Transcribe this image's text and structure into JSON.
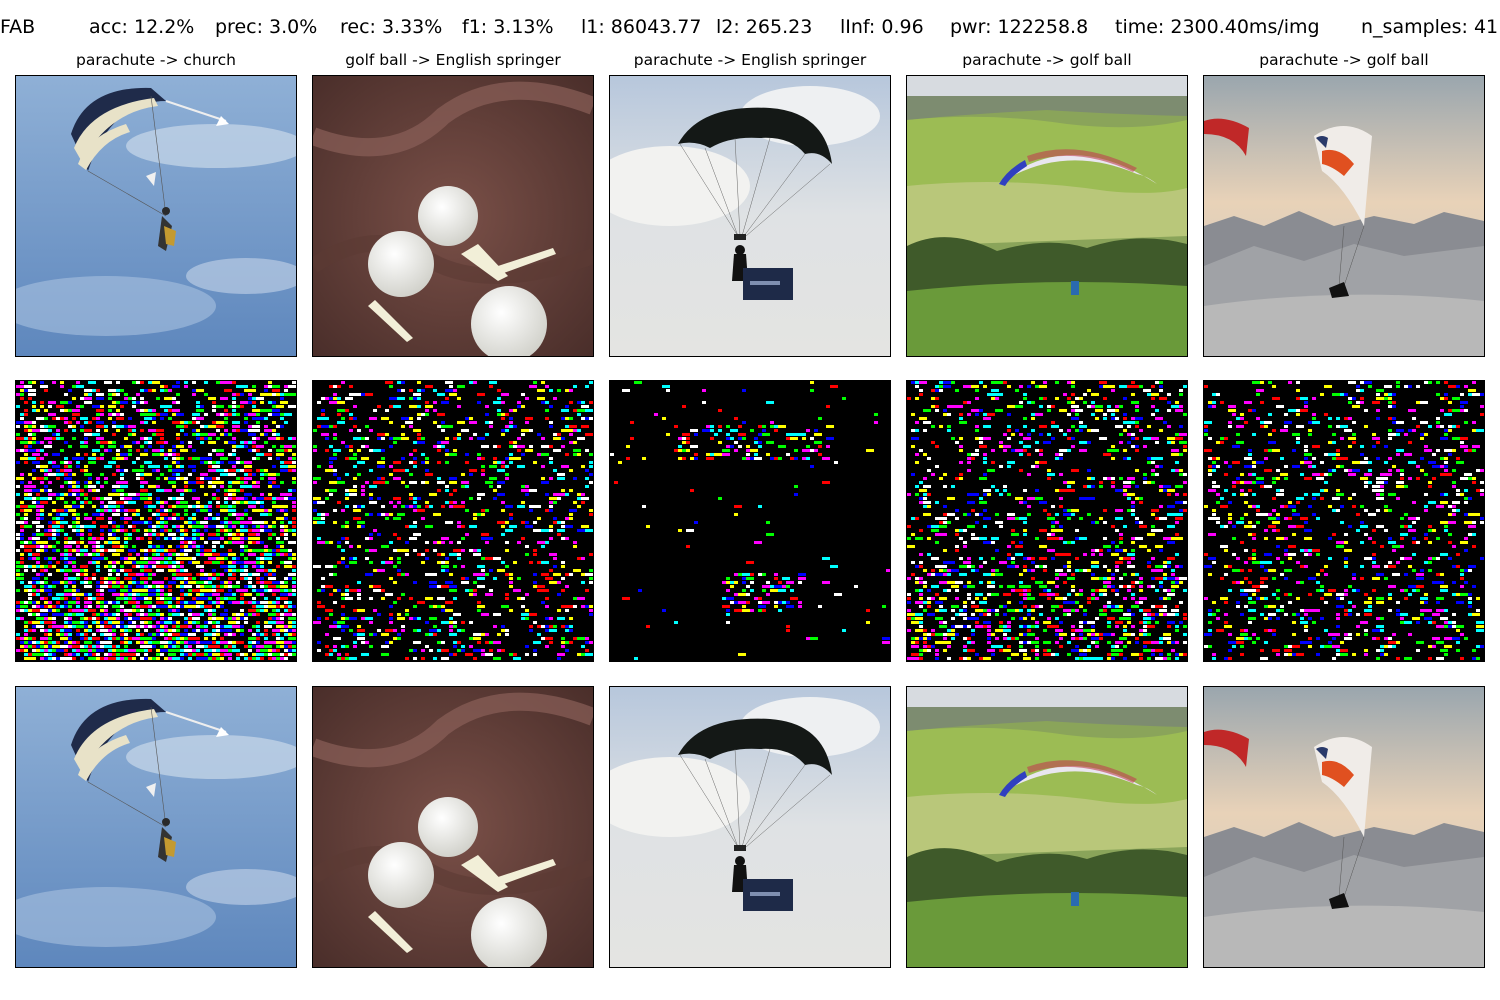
{
  "header": {
    "attack": "FAB",
    "acc": "acc: 12.2%",
    "prec": "prec: 3.0%",
    "rec": "rec: 3.33%",
    "f1": "f1: 3.13%",
    "l1": "l1: 86043.77",
    "l2": "l2: 265.23",
    "linf": "lInf: 0.96",
    "pwr": "pwr: 122258.8",
    "time": "time: 2300.40ms/img",
    "n_samples": "n_samples: 41"
  },
  "columns": [
    {
      "title": "parachute -> church",
      "scene": "skydiver"
    },
    {
      "title": "golf ball -> English springer",
      "scene": "golfballs"
    },
    {
      "title": "parachute -> English springer",
      "scene": "parachute-cloud"
    },
    {
      "title": "parachute -> golf ball",
      "scene": "paraglider-field"
    },
    {
      "title": "parachute -> golf ball",
      "scene": "paraglider-mountains"
    }
  ],
  "rows": [
    "original",
    "perturbation",
    "adversarial"
  ],
  "colors": {
    "noise": [
      "#ff0000",
      "#00ff00",
      "#0000ff",
      "#ffff00",
      "#00ffff",
      "#ff00ff",
      "#ffffff"
    ],
    "noise_background": "#000000"
  }
}
